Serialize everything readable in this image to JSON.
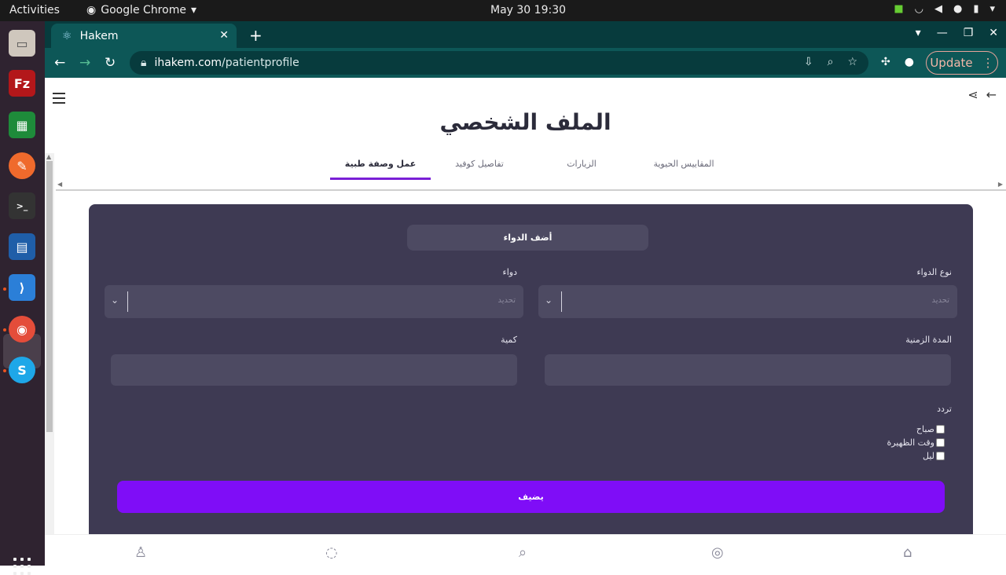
{
  "system": {
    "activities": "Activities",
    "app_name": "Google Chrome",
    "clock": "May 30  19:30"
  },
  "browser": {
    "tab_title": "Hakem",
    "url_host": "ihakem.com",
    "url_path": "/patientprofile",
    "update_label": "Update"
  },
  "page": {
    "title": "الملف الشخصي",
    "tabs": [
      {
        "label": "المقاييس الحيوية"
      },
      {
        "label": "الزيارات"
      },
      {
        "label": "تفاصيل كوفيد"
      },
      {
        "label": "عمل وصفة طبية",
        "active": true
      }
    ]
  },
  "form": {
    "header": "أضف الدواء",
    "medicine_type": {
      "label": "نوع الدواء",
      "placeholder": "تحديد"
    },
    "medicine": {
      "label": "دواء",
      "placeholder": "تحديد"
    },
    "duration": {
      "label": "المدة الزمنية",
      "value": ""
    },
    "quantity": {
      "label": "كمية",
      "value": ""
    },
    "frequency_label": "تردد",
    "frequency_options": [
      {
        "label": "صباح",
        "checked": false
      },
      {
        "label": "وقت الظهيرة",
        "checked": false
      },
      {
        "label": "ليل",
        "checked": false
      }
    ],
    "submit": "يضيف"
  }
}
